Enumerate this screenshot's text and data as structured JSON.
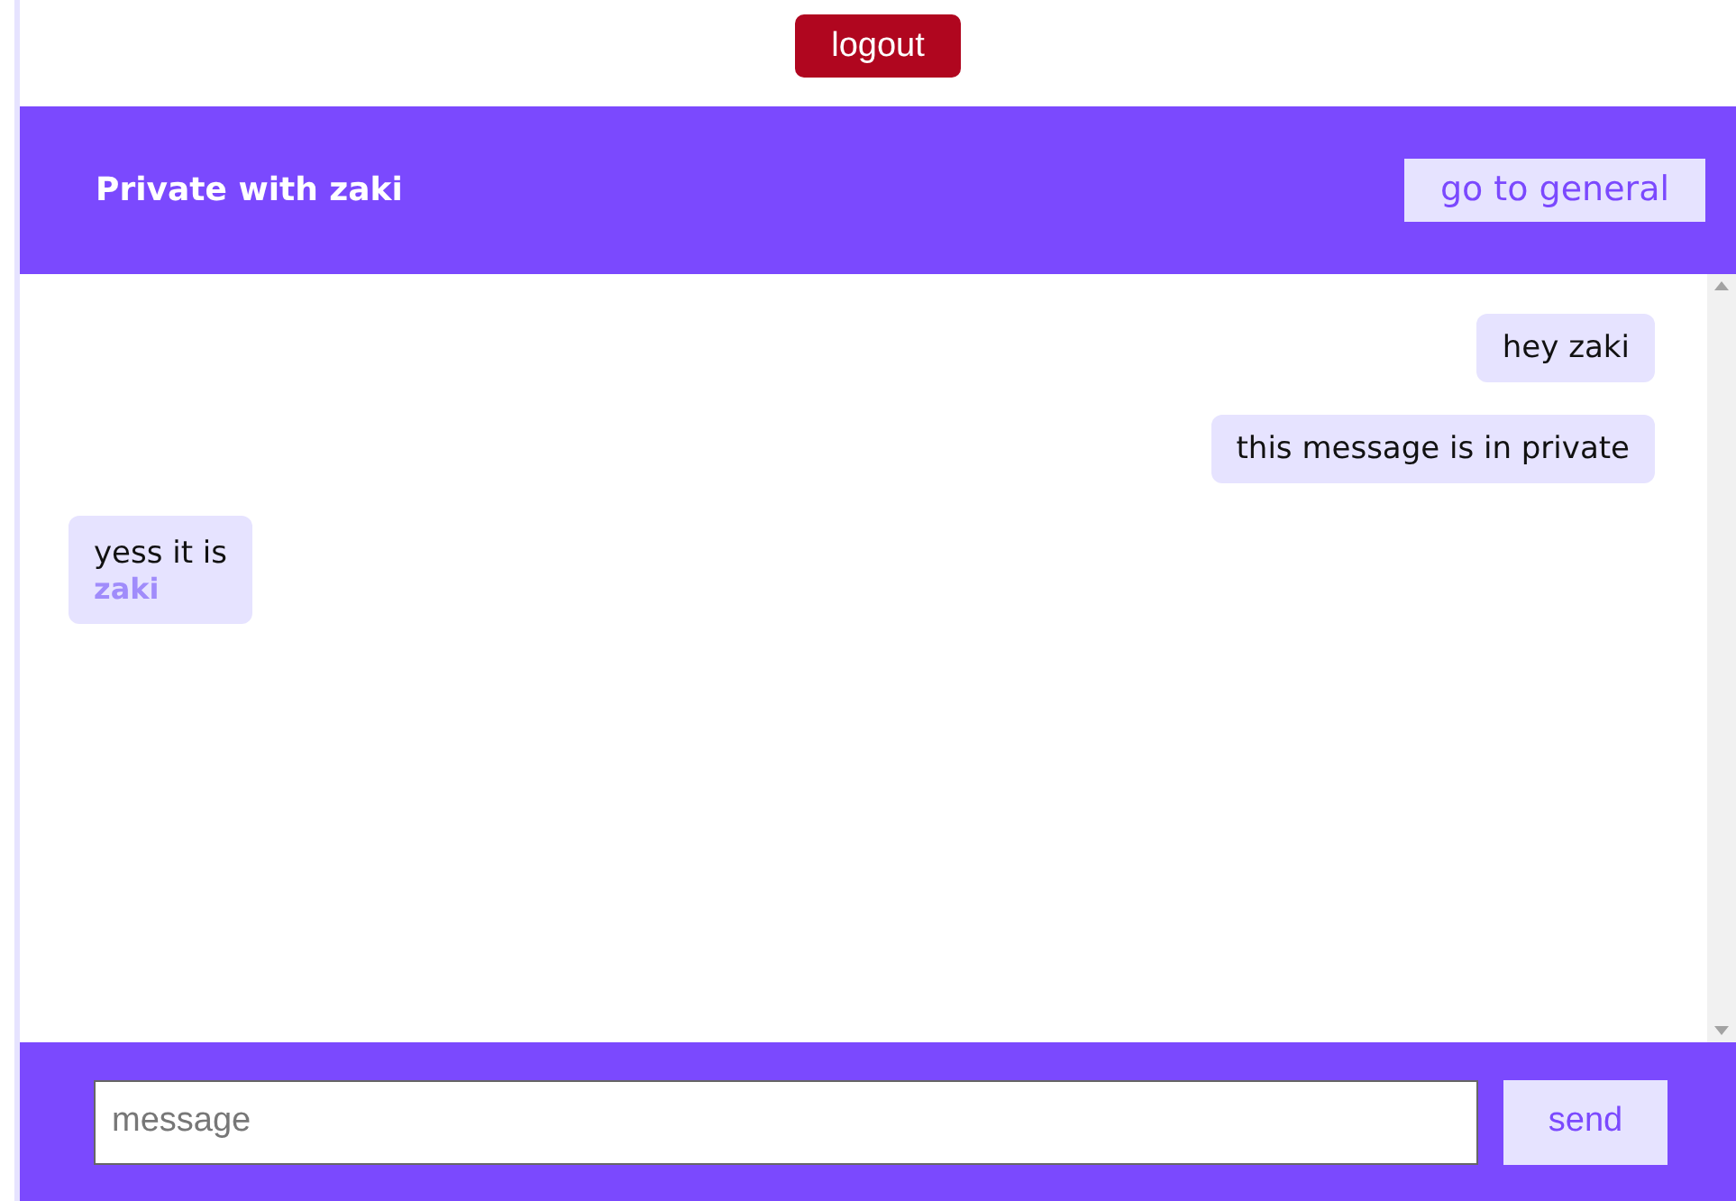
{
  "logout_button": "logout",
  "header": {
    "title": "Private with zaki",
    "general_button": "go to general"
  },
  "messages": [
    {
      "kind": "sent",
      "text": "hey zaki"
    },
    {
      "kind": "sent",
      "text": "this message is in private"
    },
    {
      "kind": "received",
      "text": "yess it is",
      "author": "zaki"
    }
  ],
  "composer": {
    "placeholder": "message",
    "send_button": "send"
  }
}
